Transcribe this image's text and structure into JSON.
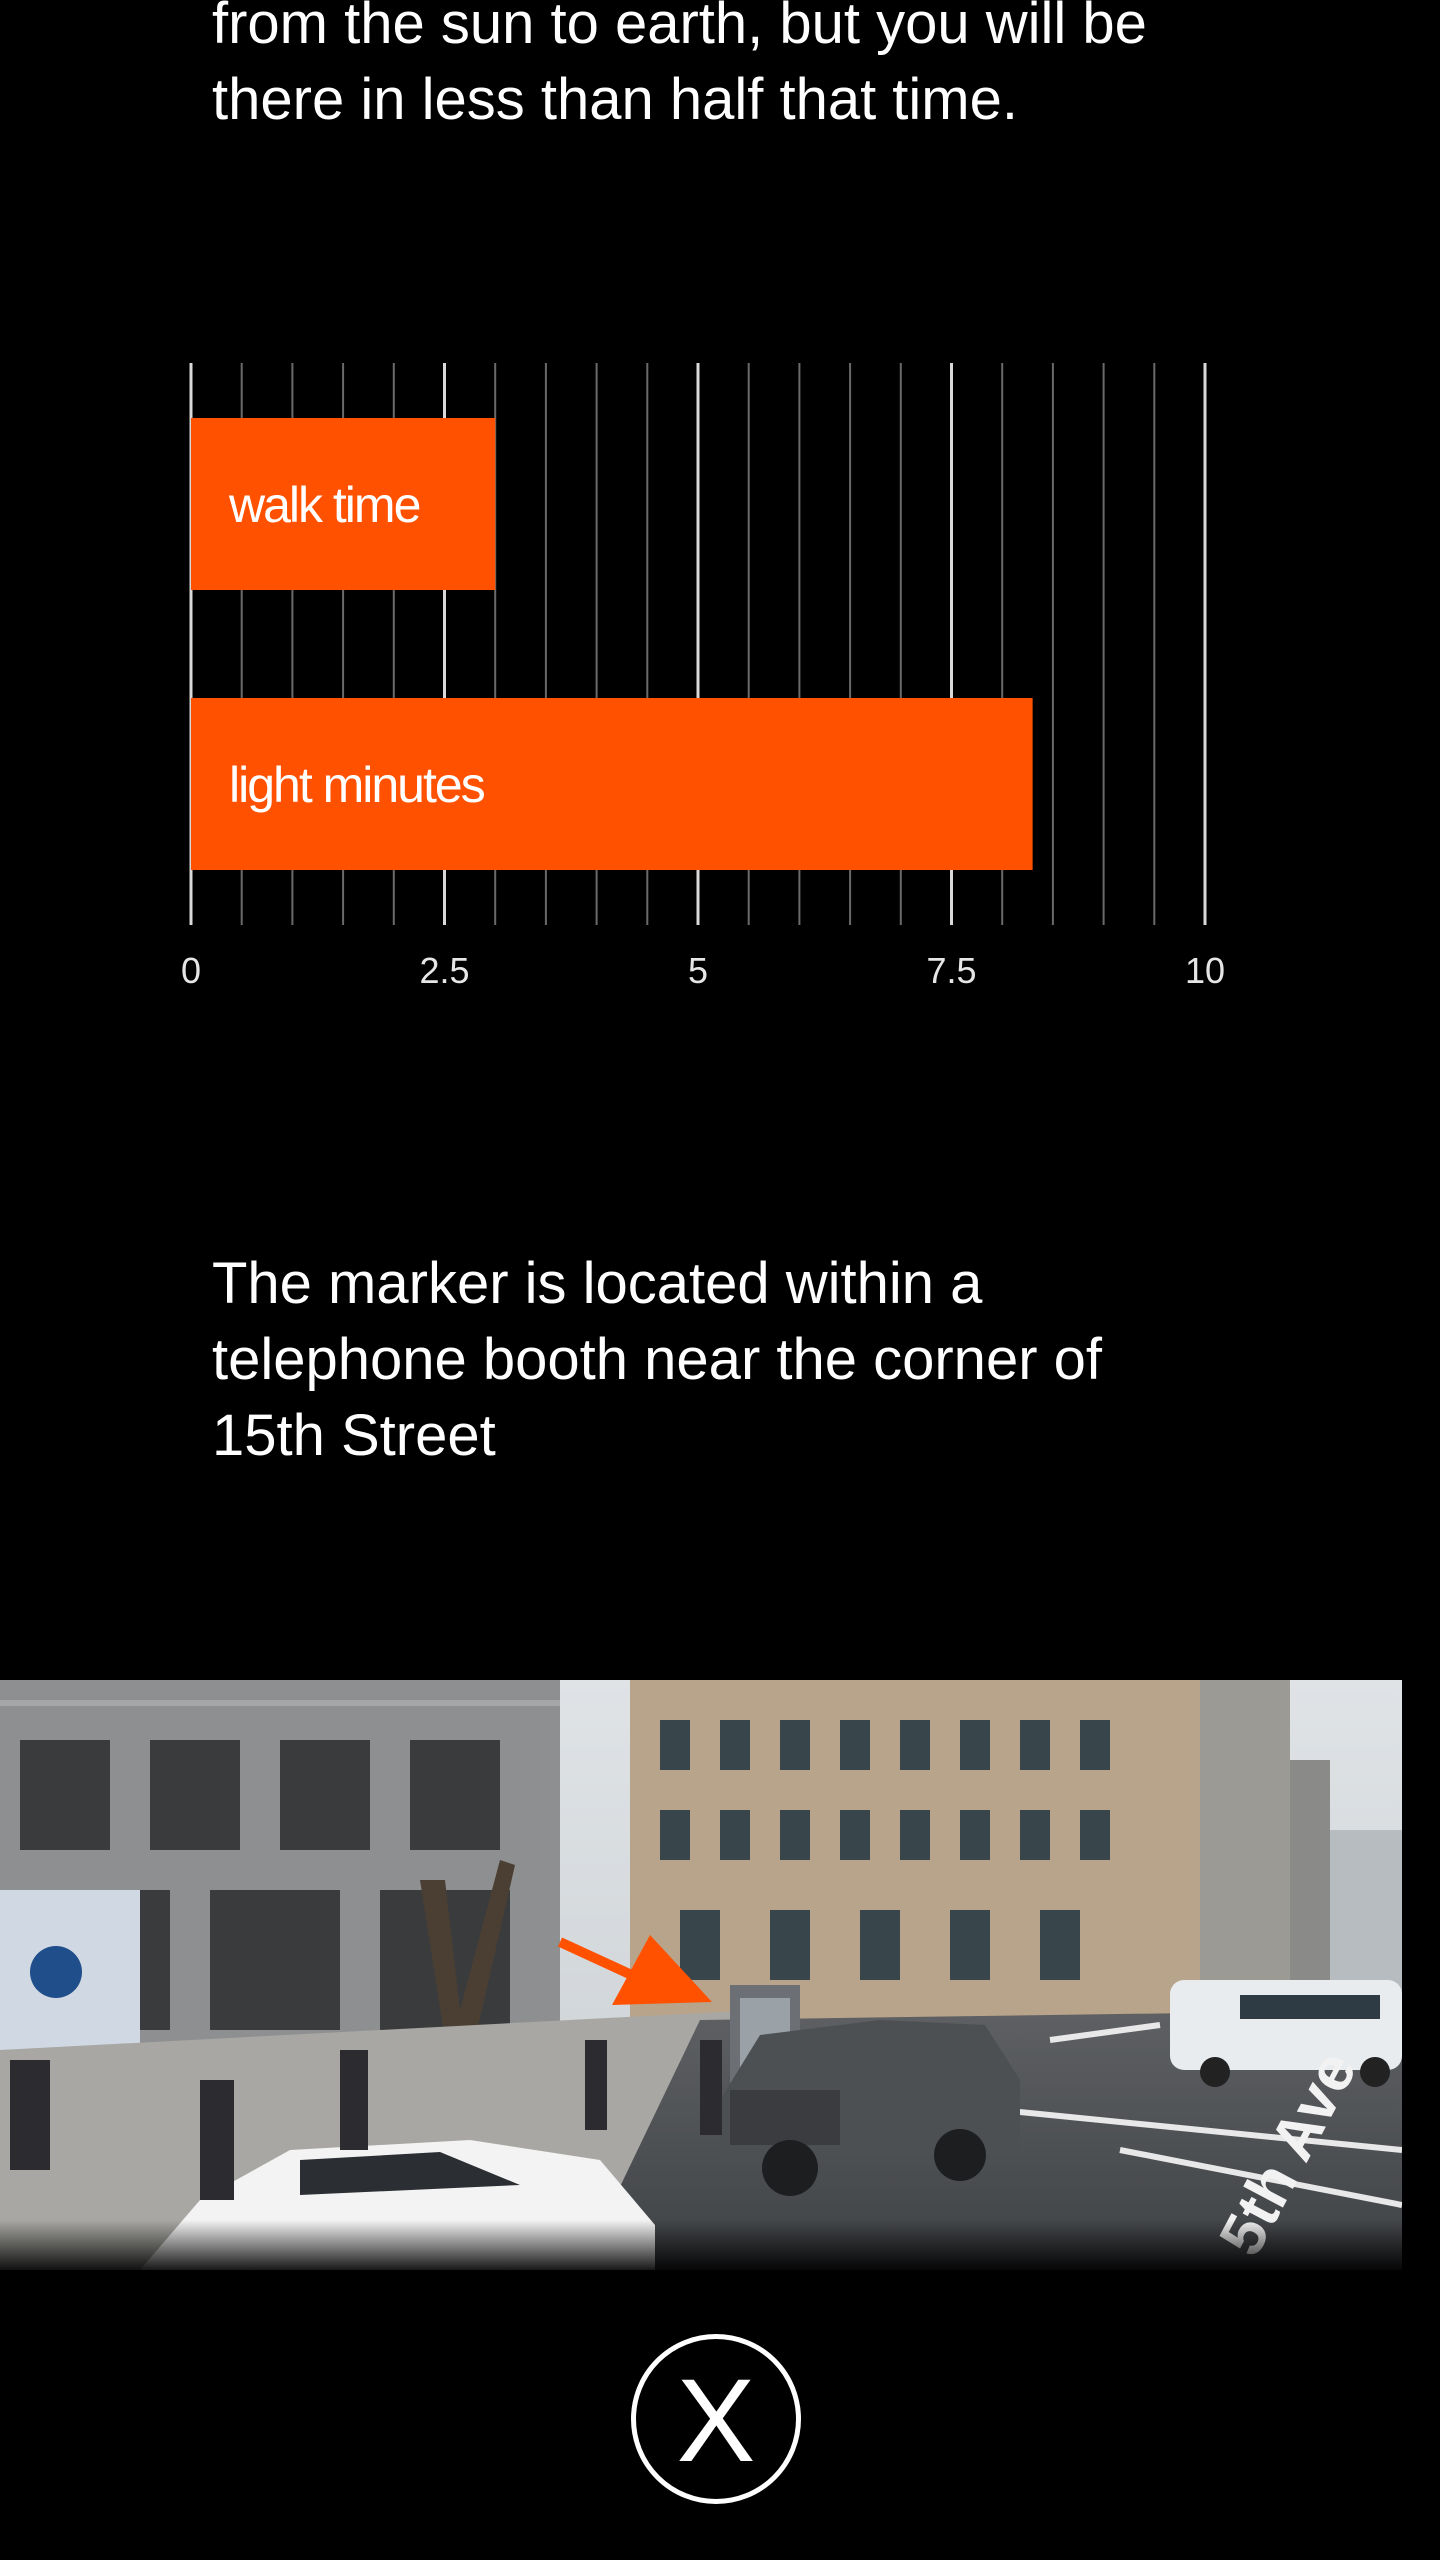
{
  "intro": {
    "text": "from the sun to earth, but you will be there in less than half that time."
  },
  "chart_data": {
    "type": "bar",
    "orientation": "horizontal",
    "categories": [
      "walk time",
      "light minutes"
    ],
    "values": [
      3.0,
      8.3
    ],
    "xlim": [
      0,
      10
    ],
    "xticks": [
      "0",
      "2.5",
      "5",
      "7.5",
      "10"
    ],
    "grid": true,
    "bar_color": "#ff5100",
    "label_position": "inside-left"
  },
  "marker": {
    "text": "The marker is located within a telephone booth near the corner of 15th Street"
  },
  "photo": {
    "street_sign": "5th Ave",
    "arrow_color": "#ff5100"
  },
  "close": {
    "label": "X"
  }
}
